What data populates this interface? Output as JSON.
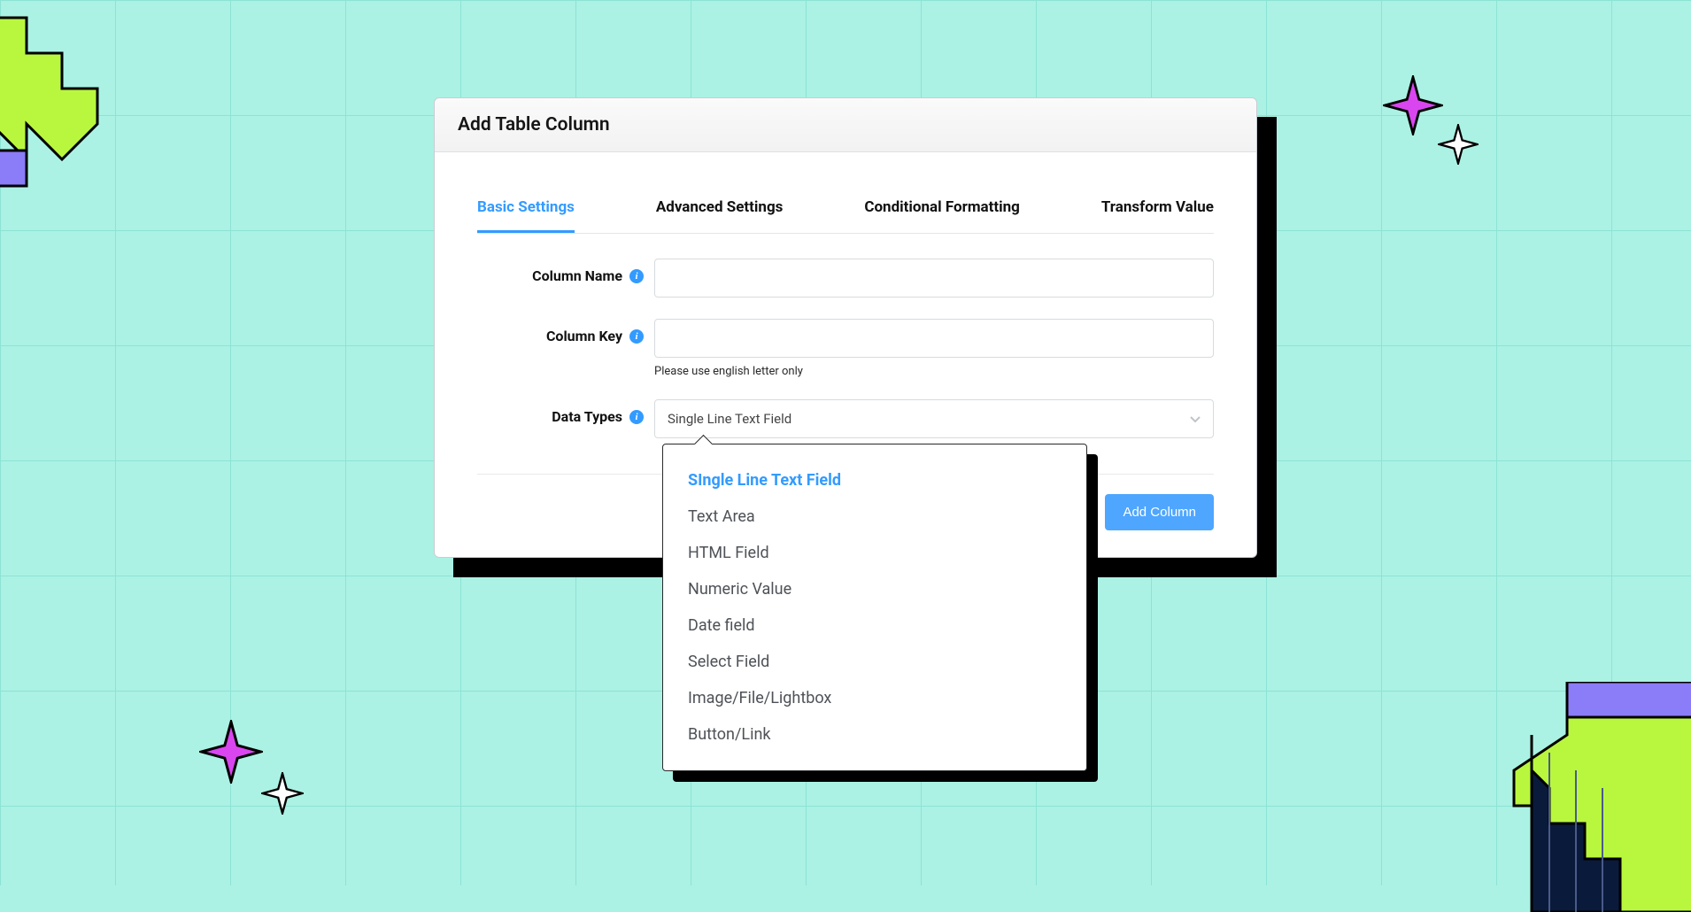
{
  "modal": {
    "title": "Add Table Column",
    "tabs": [
      {
        "label": "Basic Settings",
        "active": true
      },
      {
        "label": "Advanced Settings",
        "active": false
      },
      {
        "label": "Conditional Formatting",
        "active": false
      },
      {
        "label": "Transform Value",
        "active": false
      }
    ],
    "fields": {
      "column_name": {
        "label": "Column Name",
        "value": ""
      },
      "column_key": {
        "label": "Column Key",
        "value": "",
        "help": "Please use english letter only"
      },
      "data_types": {
        "label": "Data Types",
        "value": "Single Line Text Field"
      }
    },
    "submit_label": "Add Column"
  },
  "dropdown": {
    "options": [
      "SIngle Line Text Field",
      "Text Area",
      "HTML Field",
      "Numeric Value",
      "Date field",
      "Select Field",
      "Image/File/Lightbox",
      "Button/Link"
    ],
    "selected_index": 0
  },
  "colors": {
    "accent": "#339bff",
    "bg": "#abf2e4",
    "sparkle_purple": "#d946ef",
    "deco_lime": "#b9f73e",
    "deco_purple": "#8b7cf7"
  }
}
